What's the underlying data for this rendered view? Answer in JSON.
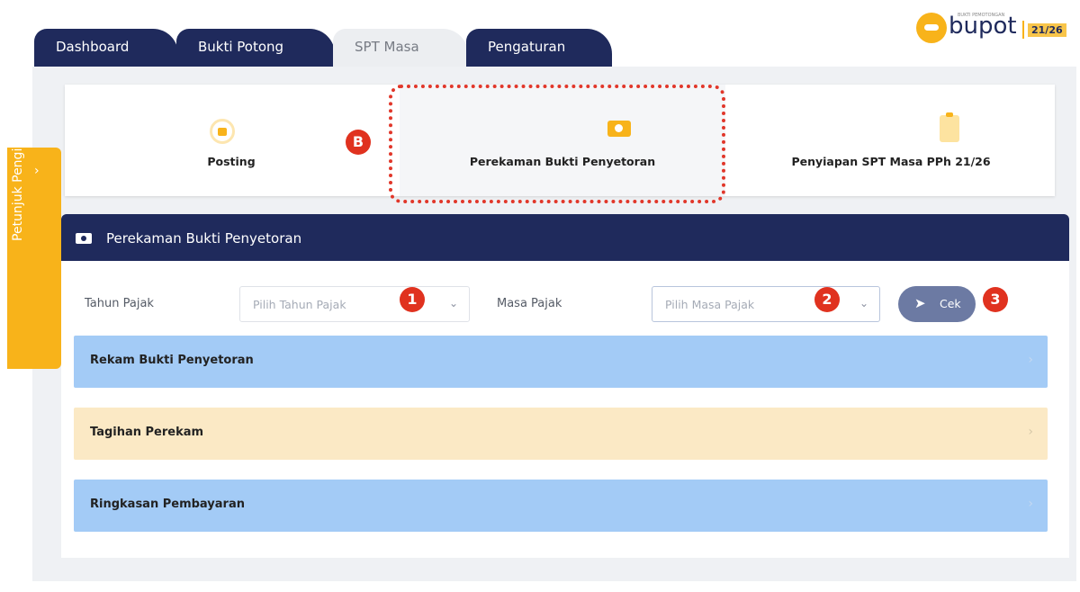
{
  "tabs": [
    {
      "label": "Dashboard",
      "active": true
    },
    {
      "label": "Bukti Potong",
      "active": true
    },
    {
      "label": "SPT Masa",
      "active": false
    },
    {
      "label": "Pengaturan",
      "active": true
    }
  ],
  "logo": {
    "text": "bupot",
    "tagline": "BUKTI PEMOTONGAN",
    "badge": "21/26",
    "color": "#f8b31a"
  },
  "cards": [
    {
      "label": "Posting",
      "icon": "lock-refresh-icon"
    },
    {
      "label": "Perekaman Bukti Penyetoran",
      "icon": "camera-icon"
    },
    {
      "label": "Penyiapan SPT Masa PPh 21/26",
      "icon": "clipboard-icon"
    }
  ],
  "annotations": {
    "b": "B",
    "one": "1",
    "two": "2",
    "three": "3"
  },
  "drawer": {
    "label": "Petunjuk Pengisian",
    "arrow": "›"
  },
  "section": {
    "title": "Perekaman Bukti Penyetoran",
    "icon": "camera-icon"
  },
  "form": {
    "tahun_label": "Tahun Pajak",
    "tahun_placeholder": "Pilih Tahun Pajak",
    "masa_label": "Masa Pajak",
    "masa_placeholder": "Pilih Masa Pajak",
    "chevron": "⌄",
    "cek_label": "Cek",
    "cek_icon": "➤"
  },
  "accordion": [
    {
      "label": "Rekam Bukti Penyetoran",
      "color": "#a3cbf6"
    },
    {
      "label": "Tagihan Perekam",
      "color": "#fbe9c5"
    },
    {
      "label": "Ringkasan Pembayaran",
      "color": "#a3cbf6"
    }
  ],
  "accordion_chevron": "›",
  "colors": {
    "navy": "#1f2a5c",
    "accent": "#f8b31a",
    "annotation": "#e0321f"
  }
}
